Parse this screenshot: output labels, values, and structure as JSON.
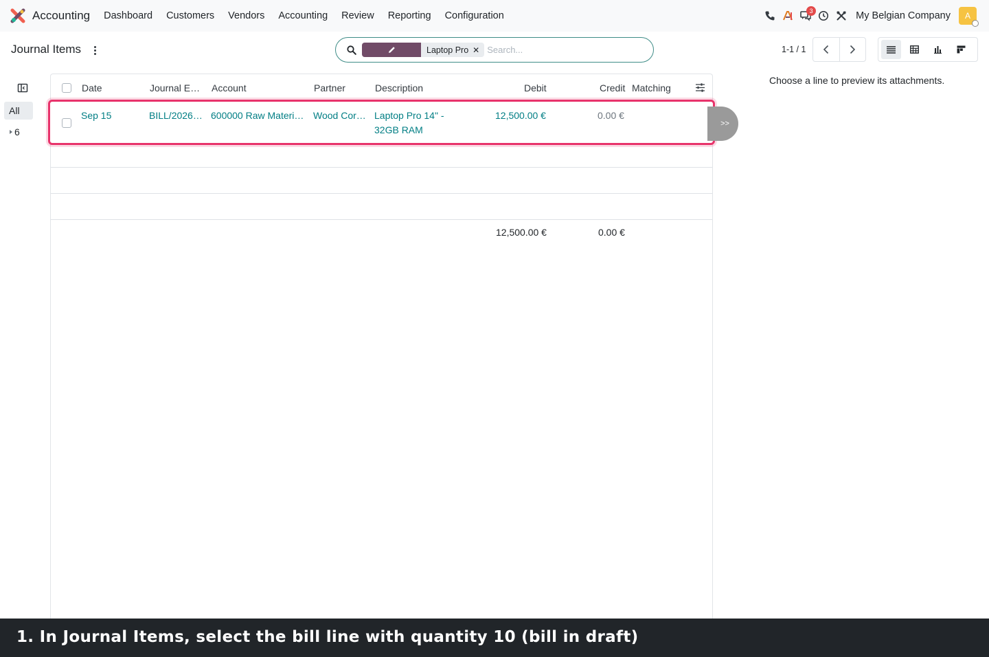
{
  "navbar": {
    "app_name": "Accounting",
    "menu": [
      "Dashboard",
      "Customers",
      "Vendors",
      "Accounting",
      "Review",
      "Reporting",
      "Configuration"
    ],
    "chat_badge": "3",
    "company": "My Belgian Company",
    "avatar_letter": "A",
    "icons": [
      "phone-icon",
      "ai-icon",
      "chat-icon",
      "activity-clock-icon",
      "tools-icon"
    ]
  },
  "control": {
    "title": "Journal Items",
    "search": {
      "facet_value": "Laptop Pro",
      "placeholder": "Search..."
    },
    "pager": "1-1 / 1"
  },
  "sidepanel": {
    "all_label": "All",
    "group_label": "6"
  },
  "list": {
    "headers": {
      "date": "Date",
      "journal_entry": "Journal E…",
      "account": "Account",
      "partner": "Partner",
      "description": "Description",
      "debit": "Debit",
      "credit": "Credit",
      "matching": "Matching"
    },
    "rows": [
      {
        "date": "Sep 15",
        "journal_entry": "BILL/2026…",
        "account": "600000 Raw Materi…",
        "partner": "Wood Cor…",
        "description_line1": "Laptop Pro 14\" -",
        "description_line2": "32GB RAM",
        "debit": "12,500.00 €",
        "credit": "0.00 €"
      }
    ],
    "totals": {
      "debit": "12,500.00 €",
      "credit": "0.00 €"
    },
    "expand_label": ">>"
  },
  "preview": {
    "hint": "Choose a line to preview its attachments."
  },
  "caption": "1. In Journal Items, select the bill line with quantity 10 (bill in draft)",
  "colors": {
    "brand": "#714b67",
    "link": "#017e84",
    "highlight": "#e8336b",
    "search_border": "#3e8c87"
  }
}
